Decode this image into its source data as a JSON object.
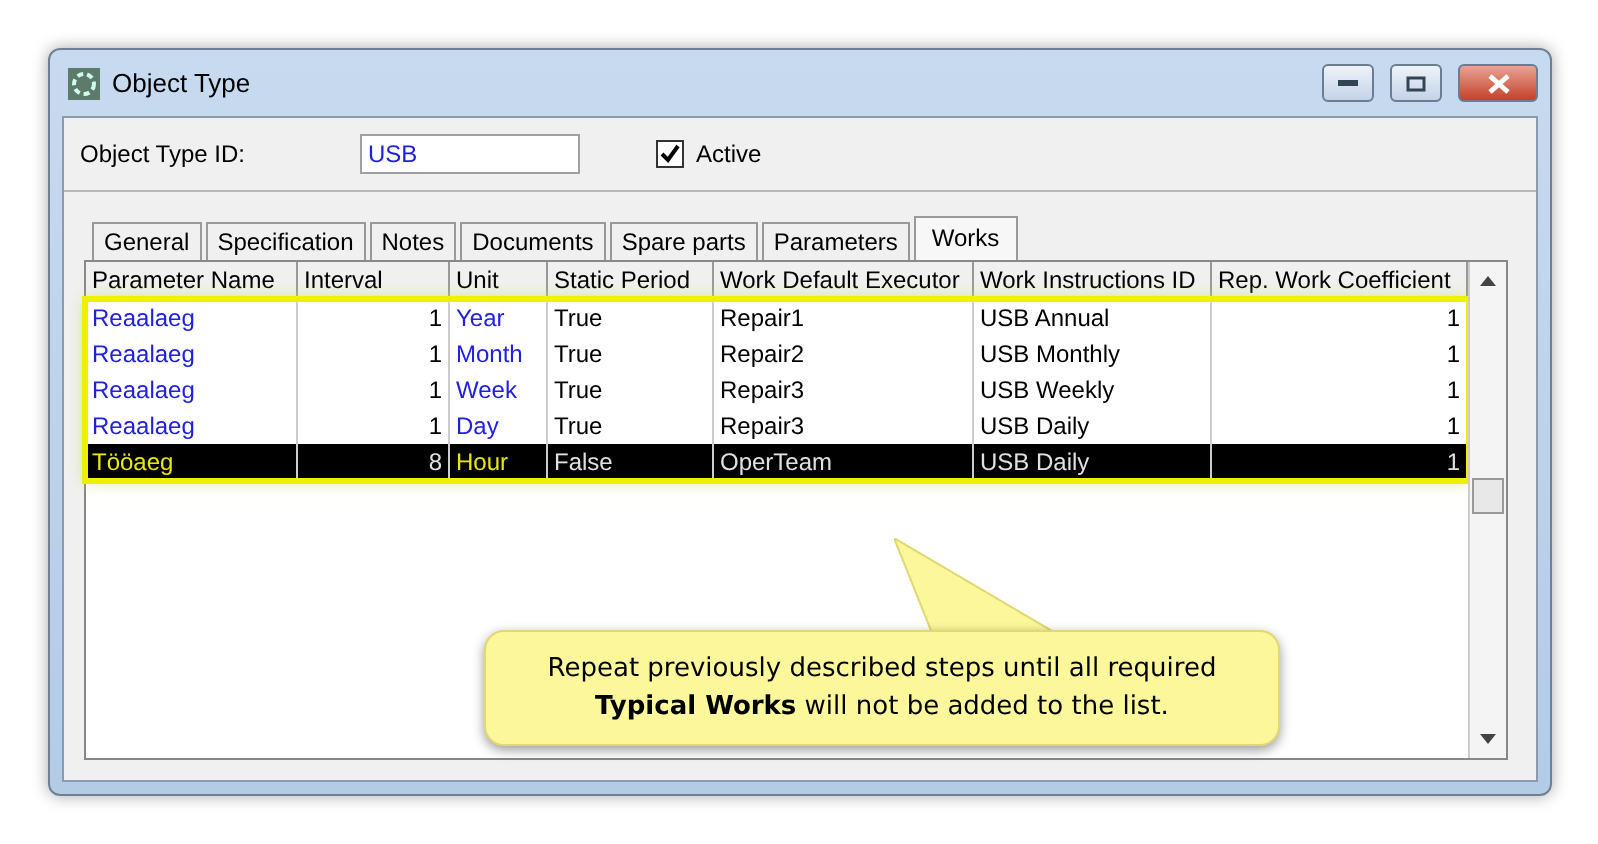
{
  "window": {
    "title": "Object Type"
  },
  "object_type_id": {
    "label": "Object Type ID:",
    "value": "USB"
  },
  "active": {
    "label": "Active",
    "checked": true
  },
  "tabs": [
    {
      "label": "General",
      "selected": false
    },
    {
      "label": "Specification",
      "selected": false
    },
    {
      "label": "Notes",
      "selected": false
    },
    {
      "label": "Documents",
      "selected": false
    },
    {
      "label": "Spare parts",
      "selected": false
    },
    {
      "label": "Parameters",
      "selected": false
    },
    {
      "label": "Works",
      "selected": true
    }
  ],
  "table": {
    "columns": [
      "Parameter Name",
      "Interval",
      "Unit",
      "Static Period",
      "Work Default Executor",
      "Work Instructions ID",
      "Rep. Work Coefficient"
    ],
    "rows": [
      {
        "cells": [
          "Reaalaeg",
          "1",
          "Year",
          "True",
          "Repair1",
          "USB Annual",
          "1"
        ],
        "selected": false
      },
      {
        "cells": [
          "Reaalaeg",
          "1",
          "Month",
          "True",
          "Repair2",
          "USB Monthly",
          "1"
        ],
        "selected": false
      },
      {
        "cells": [
          "Reaalaeg",
          "1",
          "Week",
          "True",
          "Repair3",
          "USB Weekly",
          "1"
        ],
        "selected": false
      },
      {
        "cells": [
          "Reaalaeg",
          "1",
          "Day",
          "True",
          "Repair3",
          "USB Daily",
          "1"
        ],
        "selected": false
      },
      {
        "cells": [
          "Tööaeg",
          "8",
          "Hour",
          "False",
          "OperTeam",
          "USB Daily",
          "1"
        ],
        "selected": true
      }
    ]
  },
  "callout": {
    "text": "Repeat previously described steps until all required **Typical Works** will not be added to the list."
  }
}
